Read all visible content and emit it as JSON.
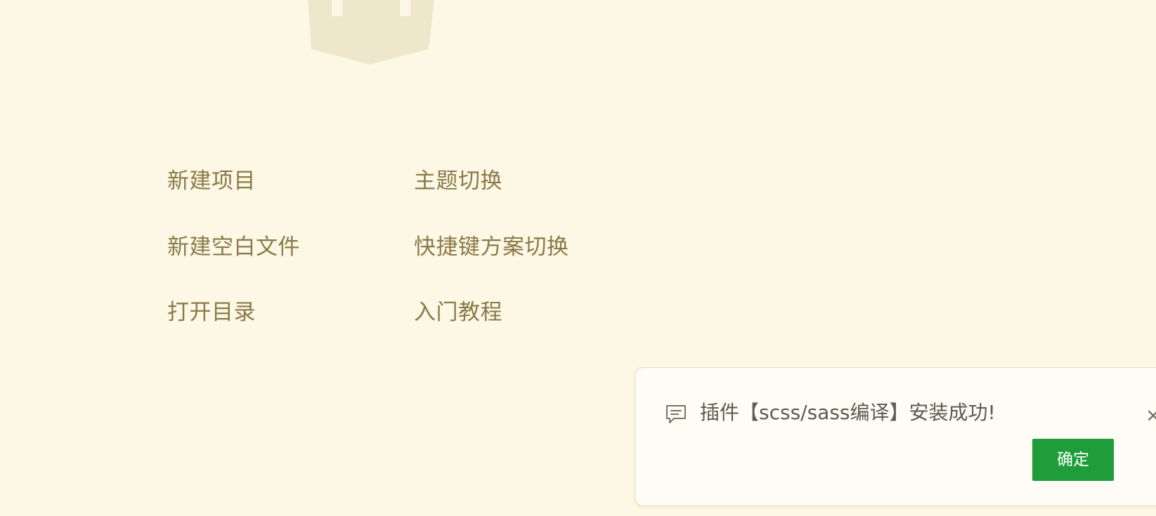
{
  "logo": {
    "icon": "hbuilder-shield-logo",
    "color": "#efe7cc"
  },
  "welcome": {
    "actions": [
      {
        "label": "新建项目"
      },
      {
        "label": "主题切换"
      },
      {
        "label": "新建空白文件"
      },
      {
        "label": "快捷键方案切换"
      },
      {
        "label": "打开目录"
      },
      {
        "label": "入门教程"
      }
    ],
    "link_color": "#8a7a48"
  },
  "notification": {
    "icon": "message-icon",
    "message": "插件【scss/sass编译】安装成功!",
    "close_label": "×",
    "confirm_label": "确定",
    "confirm_color": "#1f9d3a"
  },
  "theme": {
    "background": "#fdf8e6"
  }
}
